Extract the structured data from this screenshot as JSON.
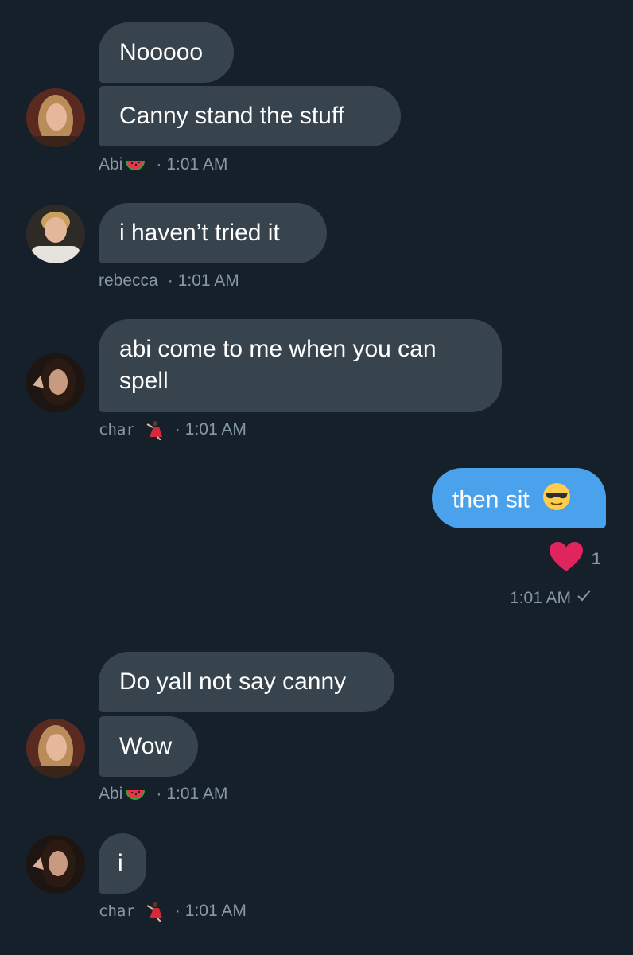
{
  "colors": {
    "background": "#15202b",
    "incoming_bubble": "#38444d",
    "outgoing_bubble": "#4aa1ec",
    "meta_text": "#8899a6",
    "heart": "#e0245e"
  },
  "messages": [
    {
      "sender": "Abi",
      "text": "Nooooo"
    },
    {
      "sender": "Abi",
      "text": "Canny stand the stuff"
    },
    {
      "sender": "rebecca",
      "text": "i haven’t tried it"
    },
    {
      "sender": "char",
      "text_line1": "abi come to me when you can",
      "text_line2": "spell"
    },
    {
      "sender": "me",
      "text": "then sit"
    },
    {
      "sender": "Abi",
      "text": "Do yall not say canny"
    },
    {
      "sender": "Abi",
      "text": "Wow"
    },
    {
      "sender": "char",
      "text": "i"
    }
  ],
  "meta": {
    "abi_1": {
      "name": "Abi",
      "emoji_icon": "watermelon-emoji",
      "time": "1:01 AM"
    },
    "rebecca": {
      "name": "rebecca",
      "time": "1:01 AM"
    },
    "char_1": {
      "name": "char",
      "emoji_icon": "dancer-emoji",
      "time": "1:01 AM"
    },
    "me": {
      "time": "1:01 AM",
      "status_icon": "checkmark-icon"
    },
    "abi_2": {
      "name": "Abi",
      "emoji_icon": "watermelon-emoji",
      "time": "1:01 AM"
    },
    "char_2": {
      "name": "char",
      "emoji_icon": "dancer-emoji",
      "time": "1:01 AM"
    }
  },
  "reaction": {
    "icon": "heart-icon",
    "count": "1"
  },
  "separator": "·"
}
